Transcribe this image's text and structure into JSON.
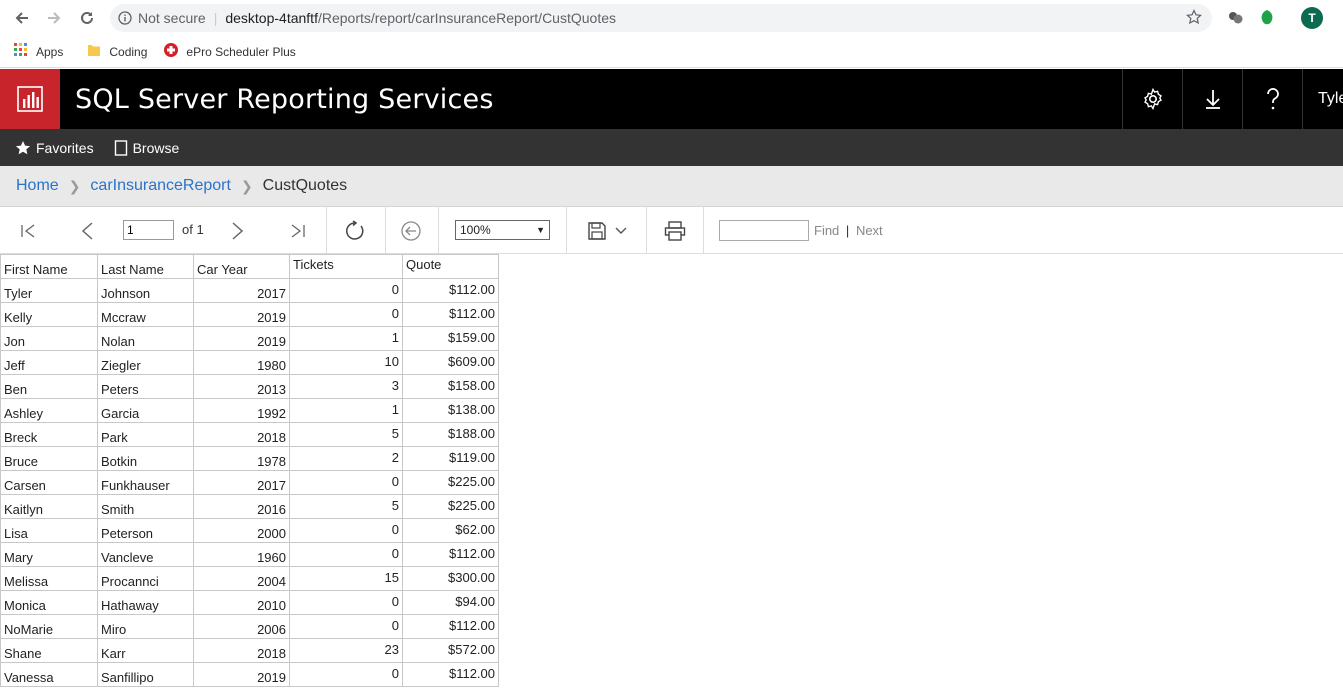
{
  "browser": {
    "security": "Not secure",
    "host": "desktop-4tanftf",
    "path": "/Reports/report/carInsuranceReport/CustQuotes",
    "avatar_letter": "T",
    "bookmarks": [
      "Apps",
      "Coding",
      "ePro Scheduler Plus"
    ]
  },
  "header": {
    "title": "SQL Server Reporting Services",
    "user": "Tyler"
  },
  "subnav": {
    "favorites": "Favorites",
    "browse": "Browse"
  },
  "breadcrumb": {
    "home": "Home",
    "folder": "carInsuranceReport",
    "current": "CustQuotes"
  },
  "toolbar": {
    "page_value": "1",
    "of_label": "of 1",
    "zoom": "100%",
    "find": "Find",
    "separator": "|",
    "next": "Next"
  },
  "table": {
    "headers": [
      "First Name",
      "Last Name",
      "Car Year",
      "Tickets",
      "Quote"
    ],
    "rows": [
      [
        "Tyler",
        "Johnson",
        "2017",
        "0",
        "$112.00"
      ],
      [
        "Kelly",
        "Mccraw",
        "2019",
        "0",
        "$112.00"
      ],
      [
        "Jon",
        "Nolan",
        "2019",
        "1",
        "$159.00"
      ],
      [
        "Jeff",
        "Ziegler",
        "1980",
        "10",
        "$609.00"
      ],
      [
        "Ben",
        "Peters",
        "2013",
        "3",
        "$158.00"
      ],
      [
        "Ashley",
        "Garcia",
        "1992",
        "1",
        "$138.00"
      ],
      [
        "Breck",
        "Park",
        "2018",
        "5",
        "$188.00"
      ],
      [
        "Bruce",
        "Botkin",
        "1978",
        "2",
        "$119.00"
      ],
      [
        "Carsen",
        "Funkhauser",
        "2017",
        "0",
        "$225.00"
      ],
      [
        "Kaitlyn",
        "Smith",
        "2016",
        "5",
        "$225.00"
      ],
      [
        "Lisa",
        "Peterson",
        "2000",
        "0",
        "$62.00"
      ],
      [
        "Mary",
        "Vancleve",
        "1960",
        "0",
        "$112.00"
      ],
      [
        "Melissa",
        "Procannci",
        "2004",
        "15",
        "$300.00"
      ],
      [
        "Monica",
        "Hathaway",
        "2010",
        "0",
        "$94.00"
      ],
      [
        "NoMarie",
        "Miro",
        "2006",
        "0",
        "$112.00"
      ],
      [
        "Shane",
        "Karr",
        "2018",
        "23",
        "$572.00"
      ],
      [
        "Vanessa",
        "Sanfillipo",
        "2019",
        "0",
        "$112.00"
      ]
    ]
  },
  "colors": {
    "brand_red": "#c8242b",
    "link_blue": "#2b73c9",
    "header_bg": "#000000",
    "subnav_bg": "#333333"
  }
}
